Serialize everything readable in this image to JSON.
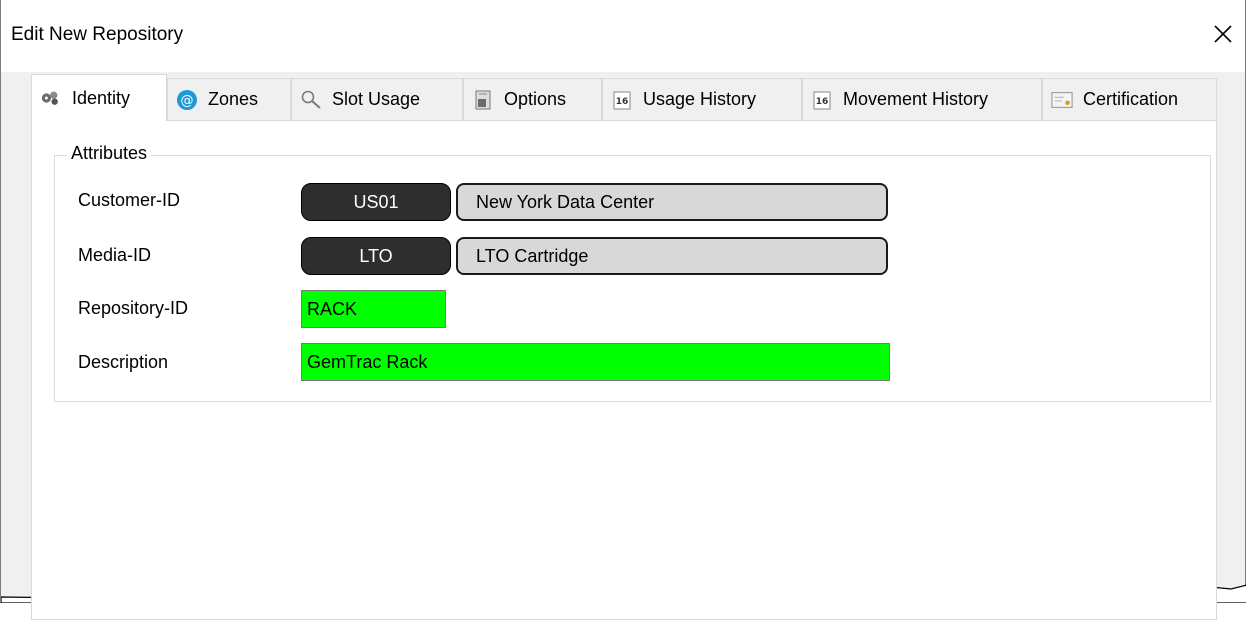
{
  "window": {
    "title": "Edit New Repository"
  },
  "tabs": [
    {
      "label": "Identity",
      "icon": "gear-cluster-icon"
    },
    {
      "label": "Zones",
      "icon": "at-sign-icon"
    },
    {
      "label": "Slot Usage",
      "icon": "magnifier-icon"
    },
    {
      "label": "Options",
      "icon": "options-icon"
    },
    {
      "label": "Usage History",
      "icon": "calendar-icon"
    },
    {
      "label": "Movement History",
      "icon": "calendar-icon"
    },
    {
      "label": "Certification",
      "icon": "certificate-icon"
    }
  ],
  "active_tab": "Identity",
  "attributes": {
    "group_label": "Attributes",
    "customer": {
      "label": "Customer-ID",
      "code": "US01",
      "description": "New York Data Center"
    },
    "media": {
      "label": "Media-ID",
      "code": "LTO",
      "description": "LTO Cartridge"
    },
    "repository": {
      "label": "Repository-ID",
      "value": "RACK"
    },
    "description": {
      "label": "Description",
      "value": "GemTrac Rack"
    }
  },
  "colors": {
    "required_field": "#00ff00",
    "code_box": "#2e2e2e",
    "lookup_box": "#d8d8d8"
  }
}
